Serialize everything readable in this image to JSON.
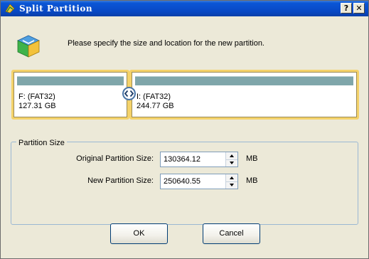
{
  "window": {
    "title": "Split Partition",
    "help_label": "?",
    "close_label": "✕"
  },
  "prompt": {
    "text": "Please specify the size and location for the new partition."
  },
  "partitions": [
    {
      "name": "F: (FAT32)",
      "size": "127.31 GB"
    },
    {
      "name": "I: (FAT32)",
      "size": "244.77 GB"
    }
  ],
  "partition_size": {
    "group_label": "Partition Size",
    "original_label": "Original Partition Size:",
    "original_value": "130364.12",
    "original_unit": "MB",
    "new_label": "New Partition Size:",
    "new_value": "250640.55",
    "new_unit": "MB"
  },
  "buttons": {
    "ok_label": "OK",
    "cancel_label": "Cancel"
  }
}
